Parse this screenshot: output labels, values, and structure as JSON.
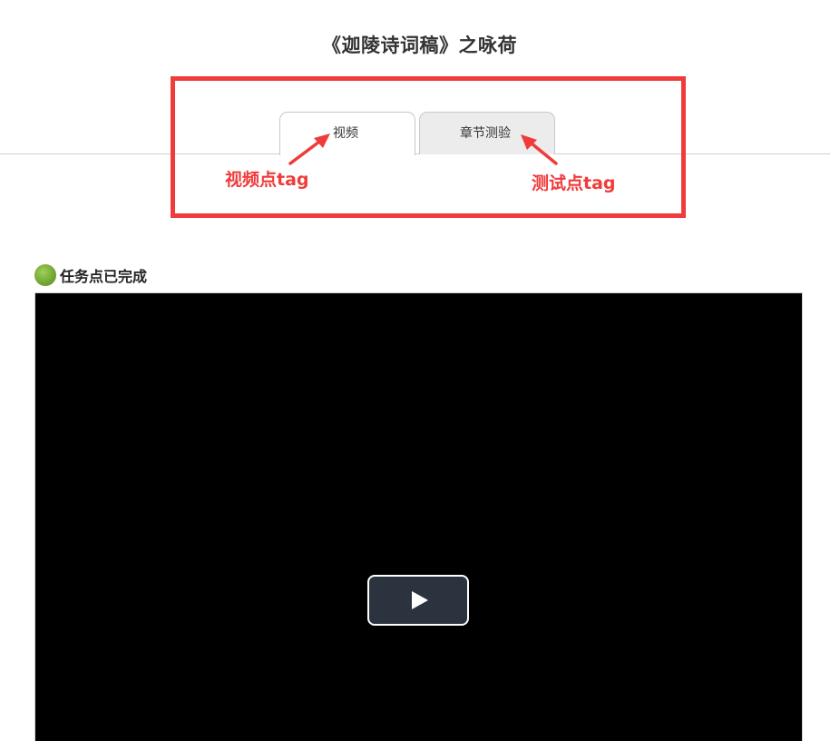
{
  "page": {
    "title": "《迦陵诗词稿》之咏荷"
  },
  "tabs": [
    {
      "label": "视频",
      "active": true
    },
    {
      "label": "章节测验",
      "active": false
    }
  ],
  "annotations": {
    "video_tag": "视频点tag",
    "quiz_tag": "测试点tag",
    "color": "#f03b3b"
  },
  "task": {
    "status_text": "任务点已完成",
    "status_color": "#6fa62f"
  },
  "video": {
    "play_icon": "play-icon"
  }
}
